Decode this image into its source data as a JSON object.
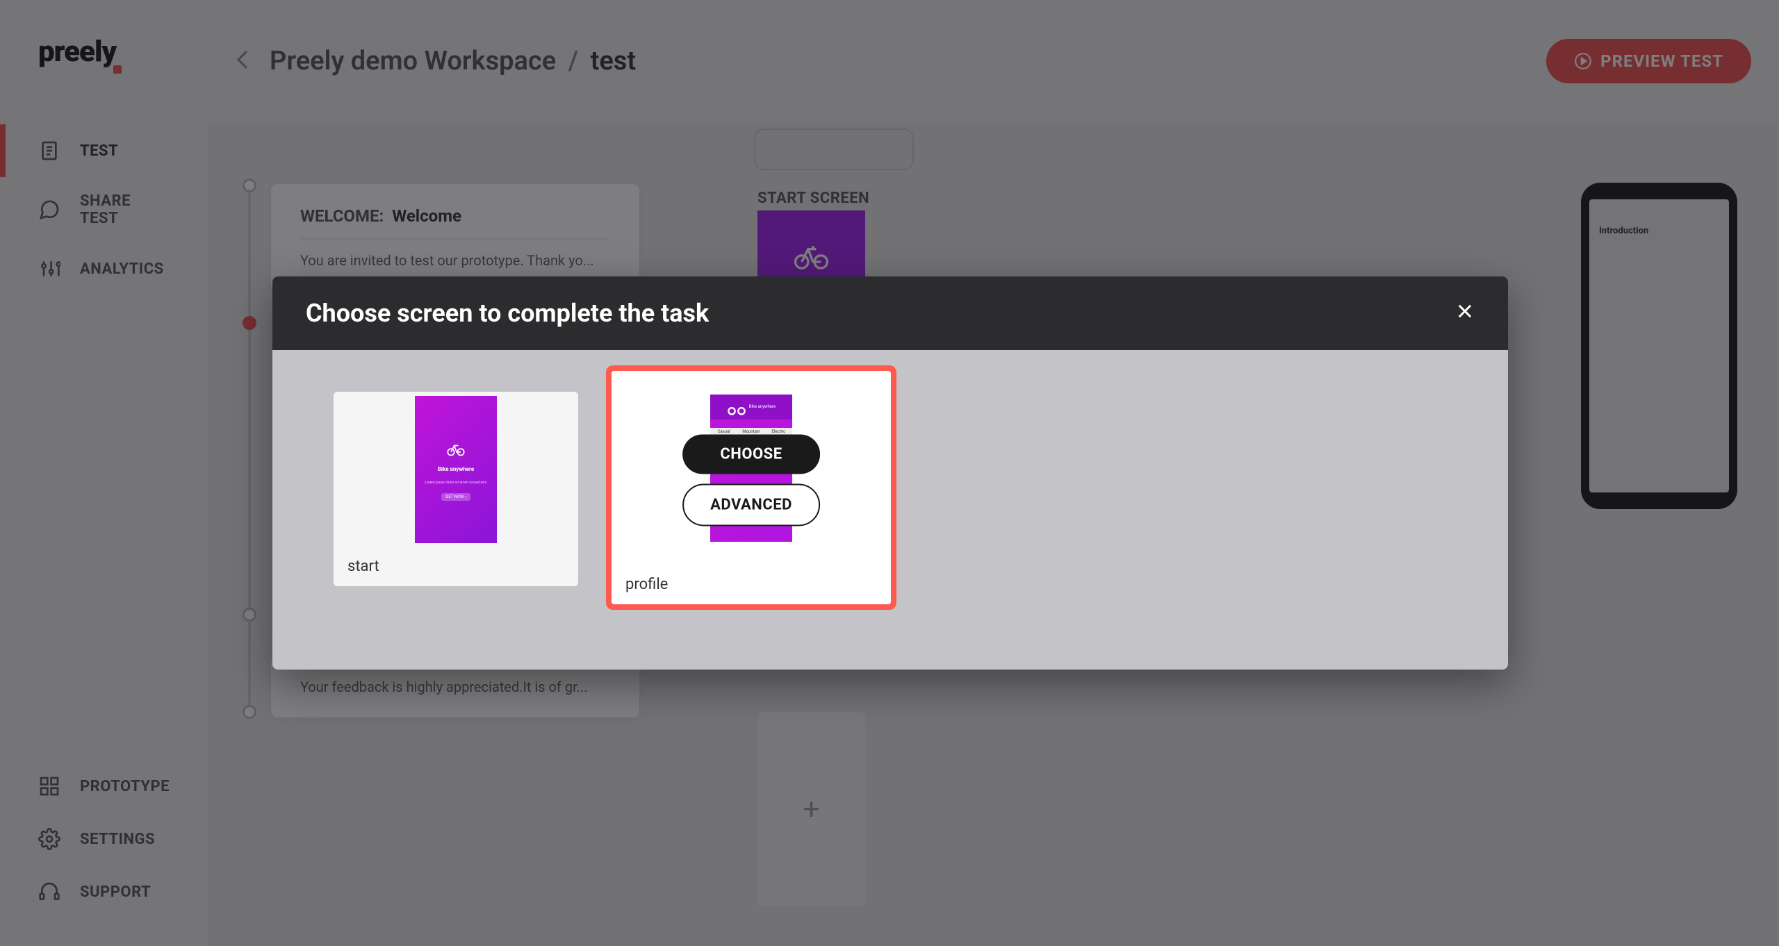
{
  "logo": "preely",
  "sidebar": {
    "top": [
      {
        "label": "TEST",
        "icon": "doc-icon",
        "active": true
      },
      {
        "label": "SHARE TEST",
        "icon": "chat-icon",
        "active": false
      },
      {
        "label": "ANALYTICS",
        "icon": "sliders-icon",
        "active": false
      }
    ],
    "bottom": [
      {
        "label": "PROTOTYPE",
        "icon": "grid-icon"
      },
      {
        "label": "SETTINGS",
        "icon": "gear-icon"
      },
      {
        "label": "SUPPORT",
        "icon": "headset-icon"
      }
    ]
  },
  "header": {
    "workspace": "Preely demo Workspace",
    "current": "test",
    "preview_label": "PREVIEW TEST"
  },
  "welcome": {
    "label": "WELCOME:",
    "title": "Welcome",
    "desc": "You are invited to test our prototype. Thank yo..."
  },
  "feedback": {
    "desc": "Your feedback is highly appreciated.It is of gr..."
  },
  "start_screen_label": "START SCREEN",
  "phone_intro": "Introduction",
  "modal": {
    "title": "Choose screen to complete the task",
    "screens": [
      {
        "label": "start",
        "selected": false
      },
      {
        "label": "profile",
        "selected": true
      }
    ],
    "choose_label": "CHOOSE",
    "advanced_label": "ADVANCED"
  }
}
